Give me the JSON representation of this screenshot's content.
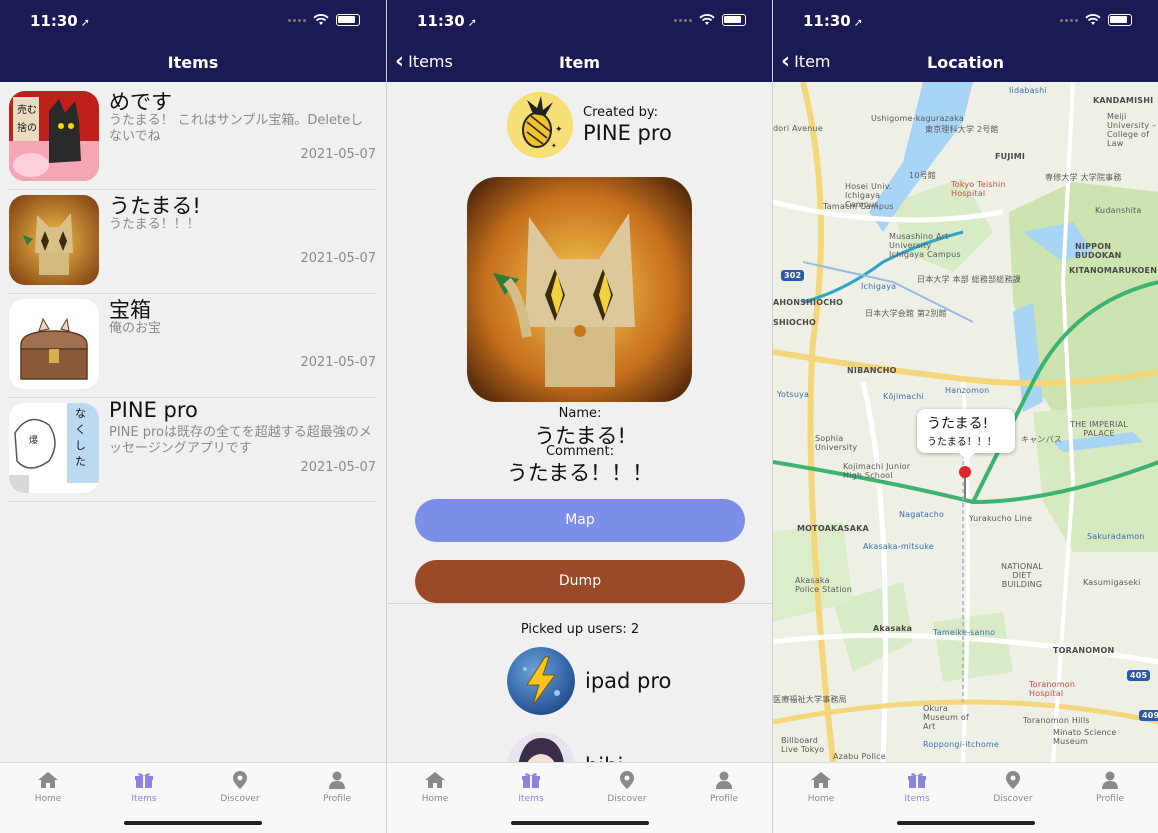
{
  "status_time": "11:30",
  "screens": {
    "list": {
      "title": "Items",
      "items": [
        {
          "name": "めです",
          "desc": "うたまる！ これはサンプル宝箱。Deleteしないでね",
          "date": "2021-05-07"
        },
        {
          "name": "うたまる!",
          "desc": "うたまる！！！",
          "date": "2021-05-07"
        },
        {
          "name": "宝箱",
          "desc": "俺のお宝",
          "date": "2021-05-07"
        },
        {
          "name": "PINE pro",
          "desc": "PINE proは既存の全てを超越する超最強のメッセージングアプリです",
          "date": "2021-05-07"
        }
      ]
    },
    "item": {
      "title": "Item",
      "back_label": "Items",
      "created_by_label": "Created by:",
      "creator_name": "PINE pro",
      "name_label": "Name:",
      "name_value": "うたまる!",
      "comment_label": "Comment:",
      "comment_value": "うたまる！！！",
      "map_button": "Map",
      "dump_button": "Dump",
      "picked_up_label": "Picked up users: 2",
      "users": [
        {
          "name": "ipad pro"
        },
        {
          "name": "hibi"
        }
      ],
      "colors": {
        "map_button": "#7b8ee8",
        "dump_button": "#9a4a28"
      }
    },
    "location": {
      "title": "Location",
      "back_label": "Item",
      "callout_title": "うたまる!",
      "callout_subtitle": "うたまる！！！",
      "map_labels": [
        "Iidabashi",
        "KANDAMISHI",
        "Ushigome-kagurazaka",
        "東京理科大学 2号館",
        "Meiji University – College of Law",
        "FUJIMI",
        "10号館",
        "専修大学 大学院事務",
        "Hosei Univ. Ichigaya Campus",
        "Tokyo Teishin Hospital",
        "Kudanshita",
        "Tamachi Campus",
        "Musashino Art University Ichigaya Campus",
        "NIPPON BUDOKAN",
        "日本大学 本部 総務部総務課",
        "Ichigaya",
        "AHONSHIOCHO",
        "SHIOCHO",
        "日本大学会館 第2別館",
        "KITANOMARUKOEN",
        "NIBANCHO",
        "Kōjimachi",
        "Hanzomon",
        "Yotsuya",
        "THE IMPERIAL PALACE",
        "Sophia University",
        "キャンパス",
        "Kojimachi Junior High School",
        "Nagatacho",
        "Yurakucho Line",
        "MOTOAKASAKA",
        "Akasaka-mitsuke",
        "Sakuradamon",
        "NATIONAL DIET BUILDING",
        "Akasaka Police Station",
        "Kasumigaseki",
        "Akasaka",
        "Tameike-sanno",
        "TORANOMON",
        "医療福祉大学事務局",
        "Toranomon Hospital",
        "Okura Museum of Art",
        "Toranomon Hills",
        "Minato Science Museum",
        "Billboard Live Tokyo",
        "Roppongi-itchome",
        "Azabu Police",
        "dori Avenue"
      ],
      "route_numbers": [
        "302",
        "405",
        "409"
      ]
    }
  },
  "tabs": [
    {
      "label": "Home",
      "icon": "home-icon"
    },
    {
      "label": "Items",
      "icon": "gift-icon"
    },
    {
      "label": "Discover",
      "icon": "map-pin-icon"
    },
    {
      "label": "Profile",
      "icon": "person-icon"
    }
  ],
  "colors": {
    "nav_bar": "#1c1a55",
    "tab_active": "#8c82e0",
    "tab_inactive": "#8a8a8a"
  }
}
